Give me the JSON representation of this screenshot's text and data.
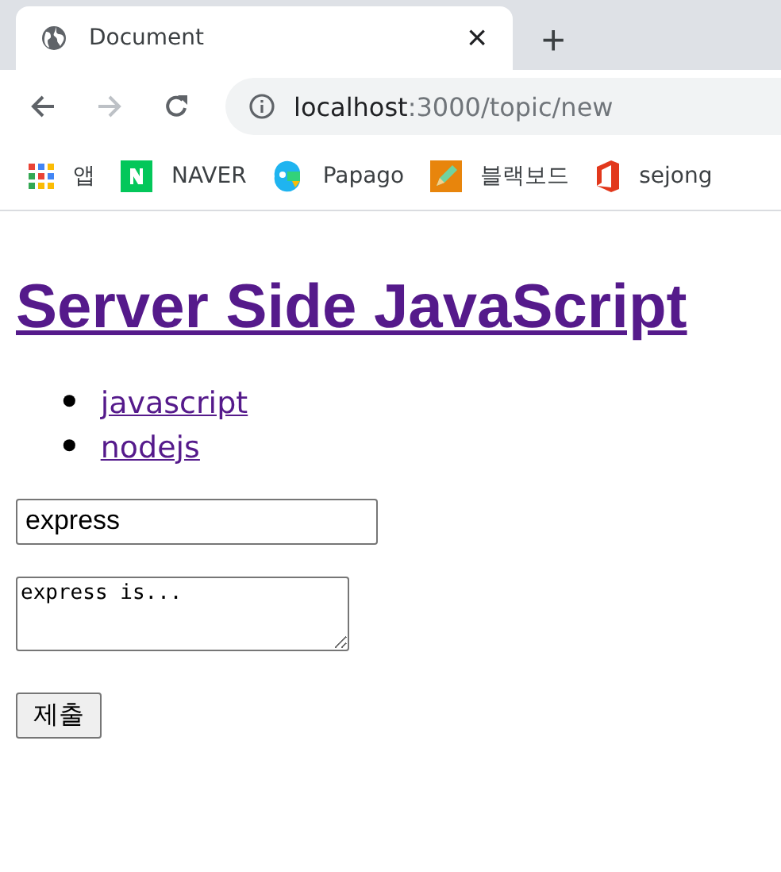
{
  "browser": {
    "tab": {
      "title": "Document",
      "close": "×"
    },
    "new_tab": "+",
    "address": {
      "host": "localhost",
      "path": ":3000/topic/new"
    },
    "bookmarks": [
      {
        "kind": "apps",
        "label": "앱"
      },
      {
        "kind": "naver",
        "label": "NAVER"
      },
      {
        "kind": "papago",
        "label": "Papago"
      },
      {
        "kind": "pencil",
        "label": "블랙보드"
      },
      {
        "kind": "office",
        "label": "sejong"
      }
    ]
  },
  "page": {
    "heading": "Server Side JavaScript",
    "links": [
      {
        "bullet": "•",
        "label": "javascript"
      },
      {
        "bullet": "•",
        "label": "nodejs"
      }
    ],
    "title_input": {
      "value": "express"
    },
    "description": {
      "value": "express is..."
    },
    "submit": "제출"
  }
}
